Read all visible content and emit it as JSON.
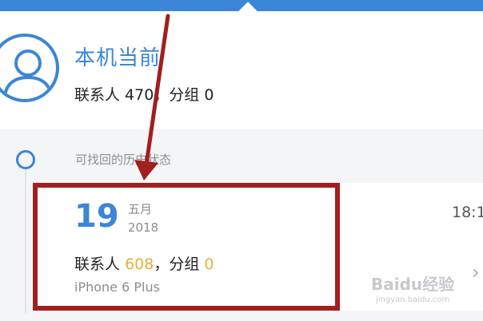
{
  "header": {
    "device_title": "本机当前",
    "contacts_summary": "联系人 470，分组 0"
  },
  "history": {
    "label": "可找回的历史状态",
    "snapshot": {
      "day": "19",
      "month": "五月",
      "year": "2018",
      "time": "18:1",
      "stats_prefix": "联系人",
      "contacts_count": "608",
      "stats_mid": "，分组",
      "groups_count": "0",
      "device_model": "iPhone 6 Plus"
    }
  },
  "watermark": {
    "logo": "Baidu经验",
    "url": "jingyan.baidu.com"
  },
  "icons": {
    "avatar": "user-avatar-icon",
    "timeline": "circle-dot-icon",
    "row_chevron": "chevron-right-icon"
  },
  "colors": {
    "accent": "#3b86d6",
    "highlight_number": "#e3b23c",
    "annotation": "#a0201f"
  }
}
